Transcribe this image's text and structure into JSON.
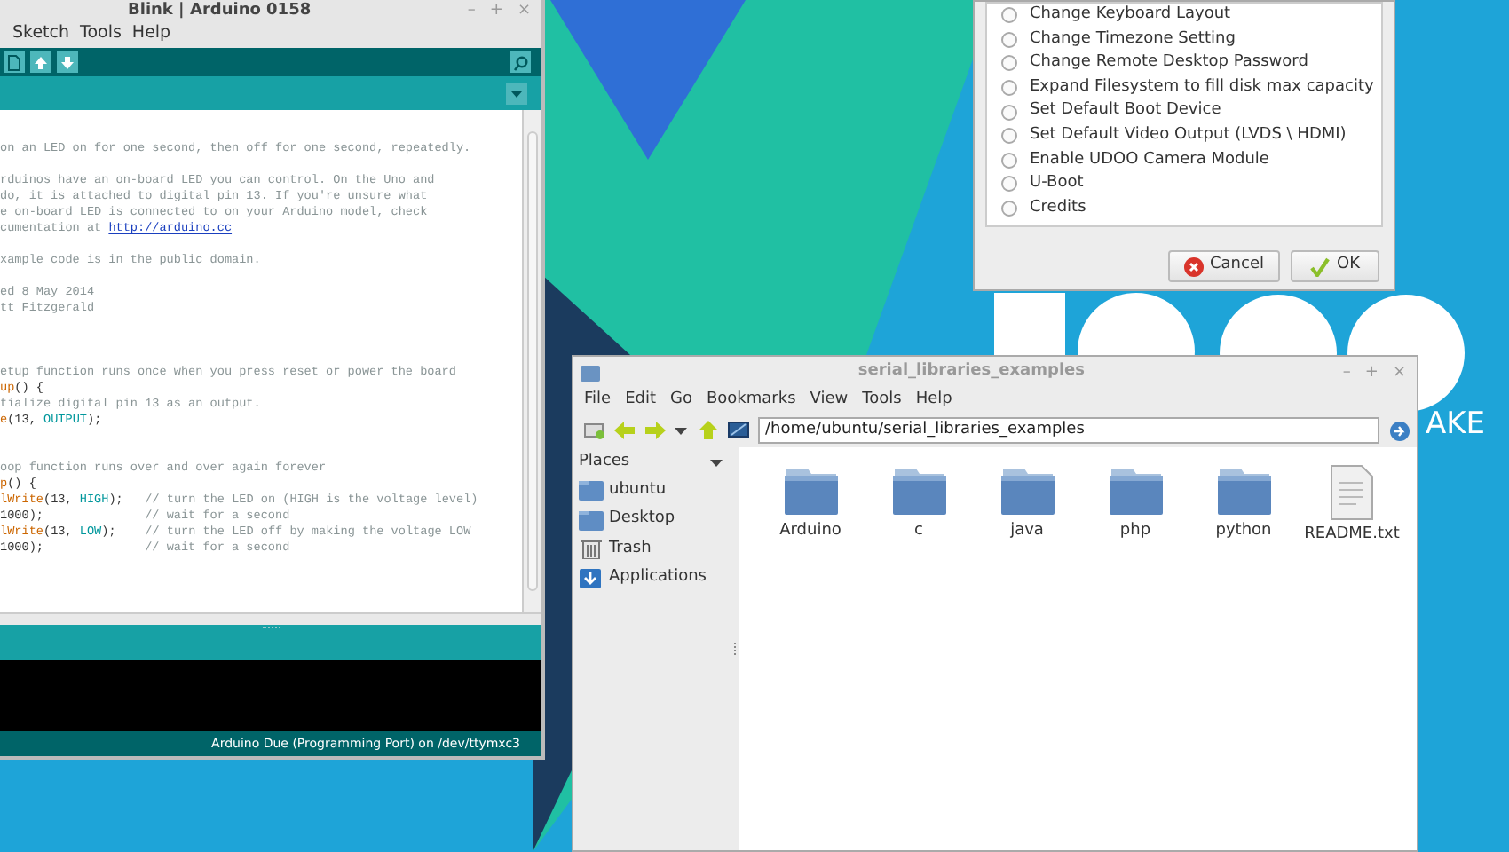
{
  "wallpaper": {
    "text": "AKE"
  },
  "arduino_window": {
    "title": "Blink | Arduino 0158",
    "controls": [
      "–",
      "+",
      "×"
    ],
    "menu": [
      "Sketch",
      "Tools",
      "Help"
    ],
    "code_lines": [
      {
        "kind": "code",
        "segments": [
          {
            "kind": "comment",
            "text": "on an LED on for one second, then off for one second, repeatedly."
          }
        ]
      },
      {
        "kind": "blank"
      },
      {
        "kind": "code",
        "segments": [
          {
            "kind": "comment",
            "text": "rduinos have an on-board LED you can control. On the Uno and"
          }
        ]
      },
      {
        "kind": "code",
        "segments": [
          {
            "kind": "comment",
            "text": "do, it is attached to digital pin 13. If you're unsure what"
          }
        ]
      },
      {
        "kind": "code",
        "segments": [
          {
            "kind": "comment",
            "text": "e on-board LED is connected to on your Arduino model, check"
          }
        ]
      },
      {
        "kind": "code",
        "segments": [
          {
            "kind": "comment",
            "text": "cumentation at "
          },
          {
            "kind": "link",
            "text": "http://arduino.cc"
          }
        ]
      },
      {
        "kind": "blank"
      },
      {
        "kind": "code",
        "segments": [
          {
            "kind": "comment",
            "text": "xample code is in the public domain."
          }
        ]
      },
      {
        "kind": "blank"
      },
      {
        "kind": "code",
        "segments": [
          {
            "kind": "comment",
            "text": "ed 8 May 2014"
          }
        ]
      },
      {
        "kind": "code",
        "segments": [
          {
            "kind": "comment",
            "text": "tt Fitzgerald"
          }
        ]
      },
      {
        "kind": "blank"
      },
      {
        "kind": "blank"
      },
      {
        "kind": "blank"
      },
      {
        "kind": "code",
        "segments": [
          {
            "kind": "comment",
            "text": "etup function runs once when you press reset or power the board"
          }
        ]
      },
      {
        "kind": "code",
        "segments": [
          {
            "kind": "keyword",
            "text": "up"
          },
          {
            "kind": "plain",
            "text": "() {"
          }
        ]
      },
      {
        "kind": "code",
        "segments": [
          {
            "kind": "comment",
            "text": "tialize digital pin 13 as an output."
          }
        ]
      },
      {
        "kind": "code",
        "segments": [
          {
            "kind": "keyword",
            "text": "e"
          },
          {
            "kind": "plain",
            "text": "(13, "
          },
          {
            "kind": "constant",
            "text": "OUTPUT"
          },
          {
            "kind": "plain",
            "text": ");"
          }
        ]
      },
      {
        "kind": "blank"
      },
      {
        "kind": "blank"
      },
      {
        "kind": "code",
        "segments": [
          {
            "kind": "comment",
            "text": "oop function runs over and over again forever"
          }
        ]
      },
      {
        "kind": "code",
        "segments": [
          {
            "kind": "keyword",
            "text": "p"
          },
          {
            "kind": "plain",
            "text": "() {"
          }
        ]
      },
      {
        "kind": "code",
        "segments": [
          {
            "kind": "keyword",
            "text": "lWrite"
          },
          {
            "kind": "plain",
            "text": "(13, "
          },
          {
            "kind": "constant",
            "text": "HIGH"
          },
          {
            "kind": "plain",
            "text": ");   "
          },
          {
            "kind": "comment",
            "text": "// turn the LED on (HIGH is the voltage level)"
          }
        ]
      },
      {
        "kind": "code",
        "segments": [
          {
            "kind": "plain",
            "text": "1000);              "
          },
          {
            "kind": "comment",
            "text": "// wait for a second"
          }
        ]
      },
      {
        "kind": "code",
        "segments": [
          {
            "kind": "keyword",
            "text": "lWrite"
          },
          {
            "kind": "plain",
            "text": "(13, "
          },
          {
            "kind": "constant",
            "text": "LOW"
          },
          {
            "kind": "plain",
            "text": ");    "
          },
          {
            "kind": "comment",
            "text": "// turn the LED off by making the voltage LOW"
          }
        ]
      },
      {
        "kind": "code",
        "segments": [
          {
            "kind": "plain",
            "text": "1000);              "
          },
          {
            "kind": "comment",
            "text": "// wait for a second"
          }
        ]
      }
    ],
    "status_bar": "Arduino Due (Programming Port) on /dev/ttymxc3"
  },
  "config_dialog": {
    "options": [
      {
        "label": "Change Keyboard Layout",
        "selected": false
      },
      {
        "label": "Change Timezone Setting",
        "selected": false
      },
      {
        "label": "Change Remote Desktop Password",
        "selected": false
      },
      {
        "label": "Expand Filesystem to fill disk max capacity",
        "selected": false
      },
      {
        "label": "Set Default Boot Device",
        "selected": false
      },
      {
        "label": "Set Default Video Output (LVDS \\ HDMI)",
        "selected": false
      },
      {
        "label": "Enable UDOO Camera Module",
        "selected": false
      },
      {
        "label": "U-Boot",
        "selected": false
      },
      {
        "label": "Credits",
        "selected": false
      }
    ],
    "buttons": [
      {
        "label": "Cancel",
        "kind": "cancel"
      },
      {
        "label": "OK",
        "kind": "ok"
      }
    ]
  },
  "file_manager": {
    "title": "serial_libraries_examples",
    "controls": [
      "–",
      "+",
      "×"
    ],
    "menu": [
      "File",
      "Edit",
      "Go",
      "Bookmarks",
      "View",
      "Tools",
      "Help"
    ],
    "path": "/home/ubuntu/serial_libraries_examples",
    "places_header": "Places",
    "places": [
      {
        "label": "ubuntu",
        "kind": "folder"
      },
      {
        "label": "Desktop",
        "kind": "folder"
      },
      {
        "label": "Trash",
        "kind": "trash"
      },
      {
        "label": "Applications",
        "kind": "apps"
      }
    ],
    "files": [
      {
        "name": "Arduino",
        "kind": "folder"
      },
      {
        "name": "c",
        "kind": "folder"
      },
      {
        "name": "java",
        "kind": "folder"
      },
      {
        "name": "php",
        "kind": "folder"
      },
      {
        "name": "python",
        "kind": "folder"
      },
      {
        "name": "README.txt",
        "kind": "text"
      }
    ]
  }
}
